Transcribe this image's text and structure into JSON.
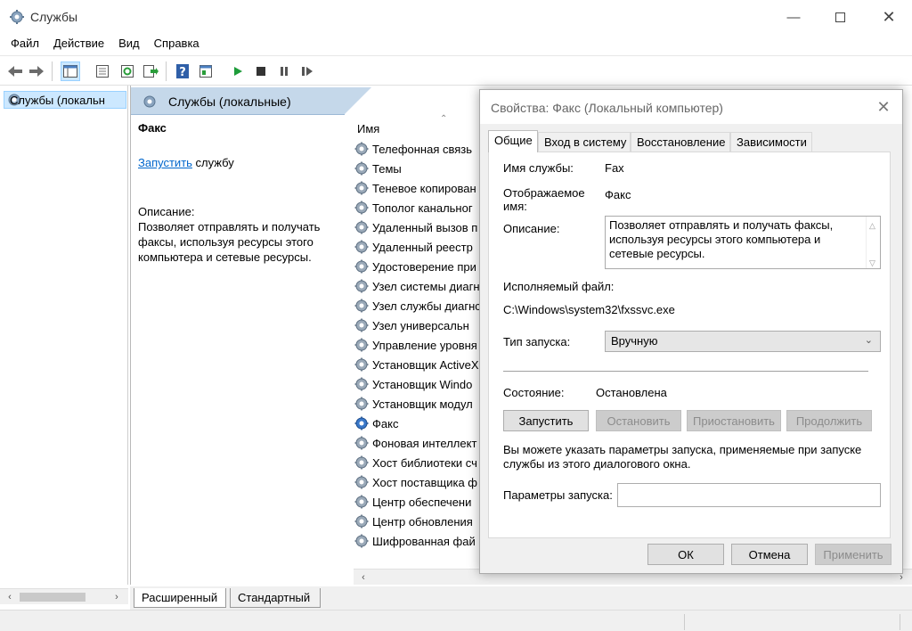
{
  "window": {
    "title": "Службы",
    "icon": "gear-icon"
  },
  "menu": [
    "Файл",
    "Действие",
    "Вид",
    "Справка"
  ],
  "toolbar": {
    "icons": [
      "back-arrow-icon",
      "forward-arrow-icon",
      "console-tree-icon",
      "properties-icon",
      "refresh-icon",
      "export-icon",
      "help-icon",
      "view-icon",
      "play-icon",
      "stop-icon",
      "pause-icon",
      "restart-icon"
    ]
  },
  "tree": {
    "item": "Службы (локальн"
  },
  "header": {
    "title": "Службы (локальные)"
  },
  "details": {
    "service_name": "Факс",
    "start_link": "Запустить",
    "start_suffix": " службу",
    "desc_label": "Описание:",
    "desc_text": "Позволяет отправлять и получать факсы, используя ресурсы этого компьютера и сетевые ресурсы."
  },
  "list": {
    "column_name": "Имя",
    "rows": [
      "Телефонная связь",
      "Темы",
      "Теневое копирован",
      "Тополог канальног",
      "Удаленный вызов п",
      "Удаленный реестр",
      "Удостоверение при",
      "Узел системы диагн",
      "Узел службы диагнс",
      "Узел универсальн",
      "Управление уровня",
      "Установщик ActiveX",
      "Установщик Windo",
      "Установщик модул",
      "Факс",
      "Фоновая интеллект",
      "Хост библиотеки сч",
      "Хост поставщика ф",
      "Центр обеспечени",
      "Центр обновления",
      "Шифрованная фай"
    ]
  },
  "bottom_tabs": [
    "Расширенный",
    "Стандартный"
  ],
  "dialog": {
    "title": "Свойства: Факс (Локальный компьютер)",
    "tabs": [
      "Общие",
      "Вход в систему",
      "Восстановление",
      "Зависимости"
    ],
    "service_name_label": "Имя службы:",
    "service_name_value": "Fax",
    "display_name_label": "Отображаемое имя:",
    "display_name_value": "Факс",
    "description_label": "Описание:",
    "description_value": "Позволяет отправлять и получать факсы, используя ресурсы этого компьютера и сетевые ресурсы.",
    "exe_label": "Исполняемый файл:",
    "exe_value": "C:\\Windows\\system32\\fxssvc.exe",
    "startup_label": "Тип запуска:",
    "startup_value": "Вручную",
    "state_label": "Состояние:",
    "state_value": "Остановлена",
    "btn_start": "Запустить",
    "btn_stop": "Остановить",
    "btn_pause": "Приостановить",
    "btn_resume": "Продолжить",
    "help_text": "Вы можете указать параметры запуска, применяемые при запуске службы из этого диалогового окна.",
    "params_label": "Параметры запуска:",
    "params_value": "",
    "btn_ok": "ОК",
    "btn_cancel": "Отмена",
    "btn_apply": "Применить"
  }
}
